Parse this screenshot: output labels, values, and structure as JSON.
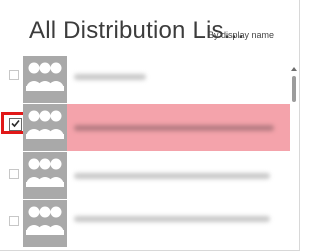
{
  "header": {
    "title": "All Distribution Lis...",
    "sort_label": "By display name"
  },
  "list": {
    "items": [
      {
        "name": "",
        "selected": false
      },
      {
        "name": "",
        "selected": true
      },
      {
        "name": "",
        "selected": false
      },
      {
        "name": "",
        "selected": false
      }
    ]
  },
  "icons": {
    "avatar": "group-icon",
    "checkbox_tick": "check-icon",
    "scroll_up": "chevron-up-icon"
  },
  "colors": {
    "selected_row": "#f4a3ab",
    "focus_ring": "#e11818",
    "avatar_bg": "#a9a9a9"
  }
}
